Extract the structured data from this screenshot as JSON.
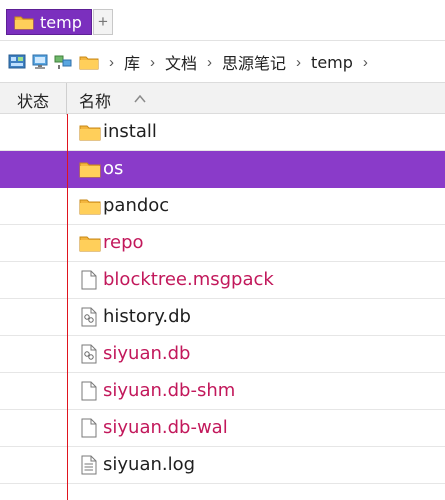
{
  "tab": {
    "label": "temp",
    "add_label": "+"
  },
  "breadcrumb": [
    "库",
    "文档",
    "思源笔记",
    "temp"
  ],
  "breadcrumb_separator": "›",
  "columns": {
    "status": "状态",
    "name": "名称"
  },
  "files": [
    {
      "name": "install",
      "type": "folder",
      "color": "dark"
    },
    {
      "name": "os",
      "type": "folder",
      "color": "white",
      "selected": true
    },
    {
      "name": "pandoc",
      "type": "folder",
      "color": "dark"
    },
    {
      "name": "repo",
      "type": "folder",
      "color": "pink"
    },
    {
      "name": "blocktree.msgpack",
      "type": "file",
      "color": "pink"
    },
    {
      "name": "history.db",
      "type": "db-file",
      "color": "dark"
    },
    {
      "name": "siyuan.db",
      "type": "db-file",
      "color": "pink"
    },
    {
      "name": "siyuan.db-shm",
      "type": "file",
      "color": "pink"
    },
    {
      "name": "siyuan.db-wal",
      "type": "file",
      "color": "pink"
    },
    {
      "name": "siyuan.log",
      "type": "text-file",
      "color": "dark"
    }
  ],
  "colors": {
    "accent": "#7b2fbe",
    "selected_row": "#8a3bc9",
    "pink_text": "#c2185b",
    "folder": "#f4b63f"
  }
}
